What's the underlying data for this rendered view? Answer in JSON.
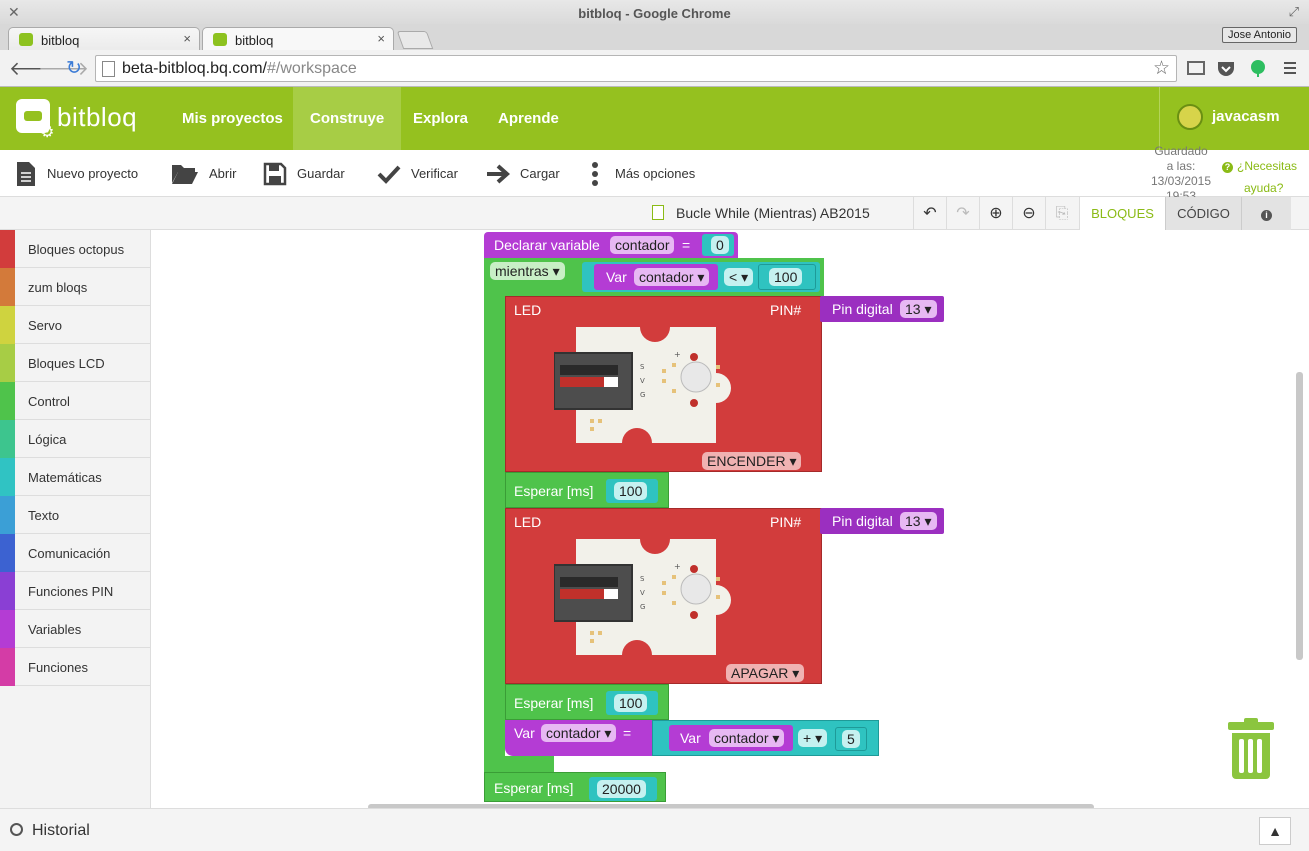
{
  "window": {
    "title": "bitbloq - Google Chrome",
    "user_badge": "Jose Antonio"
  },
  "tabs": [
    {
      "label": "bitbloq",
      "close": "×"
    },
    {
      "label": "bitbloq",
      "close": "×"
    }
  ],
  "address": {
    "url_host": "beta-bitbloq.bq.com/",
    "url_path": "#/workspace"
  },
  "app": {
    "logo": "bitbloq",
    "nav": [
      "Mis proyectos",
      "Construye",
      "Explora",
      "Aprende"
    ],
    "active_nav": "Construye",
    "user": "javacasm"
  },
  "toolbar": {
    "new": "Nuevo proyecto",
    "open": "Abrir",
    "save": "Guardar",
    "verify": "Verificar",
    "upload": "Cargar",
    "more": "Más opciones",
    "saved_line1": "Guardado",
    "saved_line2": "a las:",
    "saved_line3": "13/03/2015",
    "saved_line4": "19:53",
    "help_line1": "¿Necesitas",
    "help_line2": "ayuda?"
  },
  "project": {
    "name": "Bucle While (Mientras) AB2015",
    "tab_blocks": "BLOQUES",
    "tab_code": "CÓDIGO",
    "tab_info": "i"
  },
  "categories": [
    {
      "label": "Bloques octopus",
      "color": "#d23c3c"
    },
    {
      "label": "zum bloqs",
      "color": "#d37a3a"
    },
    {
      "label": "Servo",
      "color": "#cfd33f"
    },
    {
      "label": "Bloques LCD",
      "color": "#a7cd45"
    },
    {
      "label": "Control",
      "color": "#4fc34b"
    },
    {
      "label": "Lógica",
      "color": "#3dc58e"
    },
    {
      "label": "Matemáticas",
      "color": "#30c3c3"
    },
    {
      "label": "Texto",
      "color": "#3b9fd6"
    },
    {
      "label": "Comunicación",
      "color": "#3c62d1"
    },
    {
      "label": "Funciones PIN",
      "color": "#8a3fd4"
    },
    {
      "label": "Variables",
      "color": "#b43cd4"
    },
    {
      "label": "Funciones",
      "color": "#d43ca6"
    }
  ],
  "blocks": {
    "declare_label": "Declarar variable",
    "declare_var": "contador",
    "declare_eq": "=",
    "declare_val": "0",
    "while_label": "mientras ▾",
    "var_label": "Var",
    "cond_var": "contador ▾",
    "cond_op": "< ▾",
    "cond_val": "100",
    "led_label": "LED",
    "pin_label": "PIN#",
    "pin_digital": "Pin digital",
    "pin_num": "13 ▾",
    "led1_state": "ENCENDER ▾",
    "led2_state": "APAGAR ▾",
    "wait_label": "Esperar [ms]",
    "wait1": "100",
    "wait2": "100",
    "wait3": "20000",
    "assign_var": "contador ▾",
    "assign_eq": "=",
    "rhs_var": "contador ▾",
    "rhs_op": "+ ▾",
    "rhs_val": "5",
    "board_marks": [
      "S",
      "V",
      "G",
      "+"
    ]
  },
  "history": {
    "label": "Historial",
    "toggle": "▲"
  }
}
